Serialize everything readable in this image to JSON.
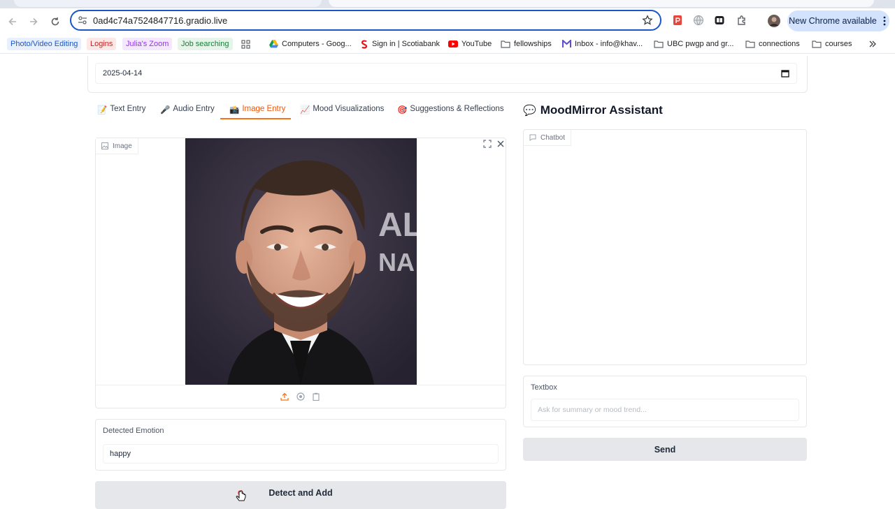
{
  "browser": {
    "url": "0ad4c74a7524847716.gradio.live",
    "update_label": "New Chrome available",
    "bookmarks": [
      {
        "label": "Photo/Video Editing",
        "color": "#1a56c8",
        "bg": "#e8f0fe",
        "kind": "chip"
      },
      {
        "label": "Logins",
        "color": "#c5221f",
        "bg": "#fce8e6",
        "kind": "chip"
      },
      {
        "label": "Julia's Zoom",
        "color": "#9334e6",
        "bg": "#f3e8fd",
        "kind": "chip"
      },
      {
        "label": "Job searching",
        "color": "#188038",
        "bg": "#e6f4ea",
        "kind": "chip"
      },
      {
        "label": "Computers - Goog...",
        "icon": "google-drive-icon"
      },
      {
        "label": "Sign in | Scotiabank",
        "icon": "scotiabank-icon"
      },
      {
        "label": "YouTube",
        "icon": "youtube-icon"
      },
      {
        "label": "fellowships",
        "icon": "folder-icon"
      },
      {
        "label": "Inbox - info@khav...",
        "icon": "mail-icon"
      },
      {
        "label": "UBC pwgp and gr...",
        "icon": "folder-icon"
      },
      {
        "label": "connections",
        "icon": "folder-icon"
      },
      {
        "label": "courses",
        "icon": "folder-icon"
      }
    ]
  },
  "app": {
    "date_value": "2025-04-14",
    "tabs": [
      {
        "emoji": "📝",
        "label": "Text Entry"
      },
      {
        "emoji": "🎤",
        "label": "Audio Entry"
      },
      {
        "emoji": "📸",
        "label": "Image Entry",
        "active": true
      },
      {
        "emoji": "📈",
        "label": "Mood Visualizations"
      },
      {
        "emoji": "🎯",
        "label": "Suggestions & Reflections"
      }
    ],
    "image_label": "Image",
    "emotion_label": "Detected Emotion",
    "emotion_value": "happy",
    "detect_button": "Detect and Add",
    "assistant": {
      "emoji": "💬",
      "title": "MoodMirror Assistant",
      "chatbot_label": "Chatbot",
      "textbox_label": "Textbox",
      "placeholder": "Ask for summary or mood trend...",
      "send_label": "Send"
    }
  },
  "colors": {
    "accent_tab": "#f97316",
    "omnibox_border": "#1a56c8",
    "update_bg": "#d3e3fd"
  }
}
